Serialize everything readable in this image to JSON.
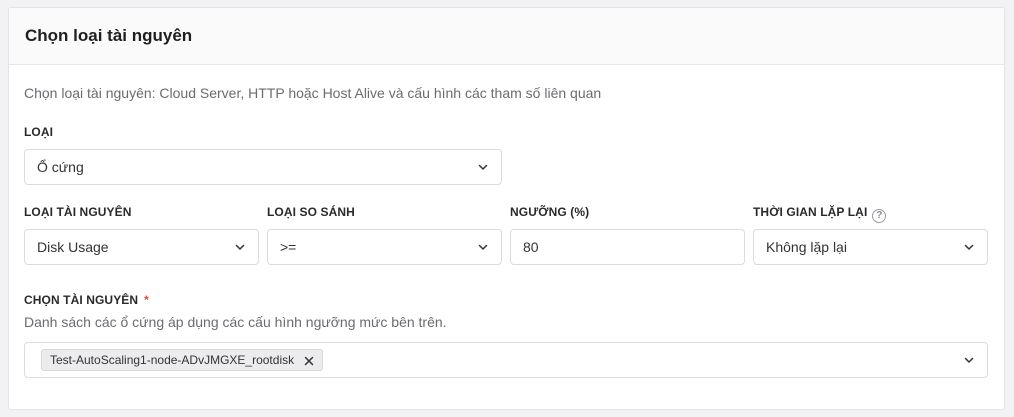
{
  "card": {
    "title": "Chọn loại tài nguyên",
    "description": "Chọn loại tài nguyên: Cloud Server, HTTP hoặc Host Alive và cấu hình các tham số liên quan"
  },
  "type": {
    "label": "LOẠI",
    "value": "Ổ cứng"
  },
  "resource_type": {
    "label": "LOẠI TÀI NGUYÊN",
    "value": "Disk Usage"
  },
  "compare_type": {
    "label": "LOẠI SO SÁNH",
    "value": ">="
  },
  "threshold": {
    "label": "NGƯỠNG (%)",
    "value": "80"
  },
  "repeat_time": {
    "label": "THỜI GIAN LẶP LẠI",
    "help_glyph": "?",
    "value": "Không lặp lại"
  },
  "choose_resource": {
    "label": "CHỌN TÀI NGUYÊN",
    "required_mark": "*",
    "description": "Danh sách các ổ cứng áp dụng các cấu hình ngưỡng mức bên trên.",
    "selected_tags": [
      "Test-AutoScaling1-node-ADvJMGXE_rootdisk"
    ]
  },
  "icons": {
    "dropdown": "chevron-down-icon",
    "remove_tag": "close-icon",
    "help": "help-circle-icon"
  },
  "colors": {
    "required": "#e04a3a",
    "border": "#dcdce0",
    "tag_bg": "#ececef"
  }
}
